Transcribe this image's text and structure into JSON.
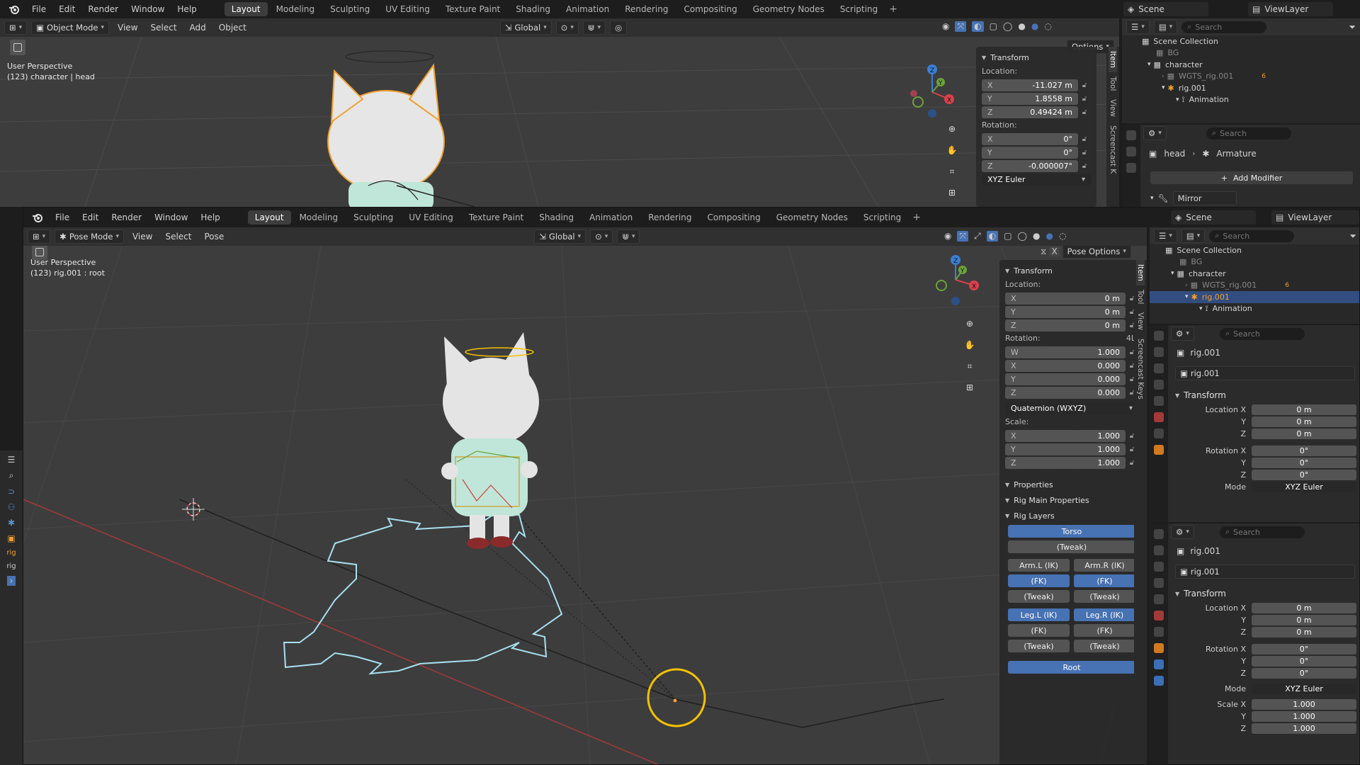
{
  "back": {
    "menus": [
      "File",
      "Edit",
      "Render",
      "Window",
      "Help"
    ],
    "workspaces": [
      "Layout",
      "Modeling",
      "Sculpting",
      "UV Editing",
      "Texture Paint",
      "Shading",
      "Animation",
      "Rendering",
      "Compositing",
      "Geometry Nodes",
      "Scripting"
    ],
    "active_workspace": "Layout",
    "scene": "Scene",
    "view_layer": "ViewLayer",
    "mode": "Object Mode",
    "header_menus": [
      "View",
      "Select",
      "Add",
      "Object"
    ],
    "orientation": "Global",
    "options": "Options",
    "overlay_line1": "User Perspective",
    "overlay_line2": "(123) character | head",
    "transform": {
      "title": "Transform",
      "location_label": "Location:",
      "loc": [
        {
          "ax": "X",
          "v": "-11.027 m"
        },
        {
          "ax": "Y",
          "v": "1.8558 m"
        },
        {
          "ax": "Z",
          "v": "0.49424 m"
        }
      ],
      "rotation_label": "Rotation:",
      "rot": [
        {
          "ax": "X",
          "v": "0°"
        },
        {
          "ax": "Y",
          "v": "0°"
        },
        {
          "ax": "Z",
          "v": "-0.000007°"
        }
      ],
      "rot_mode": "XYZ Euler"
    },
    "side_tabs": [
      "Item",
      "Tool",
      "View",
      "Screencast K"
    ],
    "outliner": {
      "search": "Search",
      "scene_collection": "Scene Collection",
      "items": [
        "BG",
        "character",
        "WGTS_rig.001",
        "rig.001",
        "Animation"
      ],
      "badge": "6"
    },
    "props": {
      "search": "Search",
      "object": "head",
      "data": "Armature",
      "add_modifier": "Add Modifier",
      "modifier": "Mirror"
    }
  },
  "front": {
    "menus": [
      "File",
      "Edit",
      "Render",
      "Window",
      "Help"
    ],
    "workspaces": [
      "Layout",
      "Modeling",
      "Sculpting",
      "UV Editing",
      "Texture Paint",
      "Shading",
      "Animation",
      "Rendering",
      "Compositing",
      "Geometry Nodes",
      "Scripting"
    ],
    "active_workspace": "Layout",
    "scene": "Scene",
    "view_layer": "ViewLayer",
    "mode": "Pose Mode",
    "header_menus": [
      "View",
      "Select",
      "Pose"
    ],
    "orientation": "Global",
    "pose_options": "Pose Options",
    "overlay_line1": "User Perspective",
    "overlay_line2": "(123) rig.001 : root",
    "transform": {
      "title": "Transform",
      "location_label": "Location:",
      "loc": [
        {
          "ax": "X",
          "v": "0 m"
        },
        {
          "ax": "Y",
          "v": "0 m"
        },
        {
          "ax": "Z",
          "v": "0 m"
        }
      ],
      "rotation_label": "Rotation:",
      "rot_tag": "4L",
      "rot": [
        {
          "ax": "W",
          "v": "1.000"
        },
        {
          "ax": "X",
          "v": "0.000"
        },
        {
          "ax": "Y",
          "v": "0.000"
        },
        {
          "ax": "Z",
          "v": "0.000"
        }
      ],
      "rot_mode": "Quaternion (WXYZ)",
      "scale_label": "Scale:",
      "scale": [
        {
          "ax": "X",
          "v": "1.000"
        },
        {
          "ax": "Y",
          "v": "1.000"
        },
        {
          "ax": "Z",
          "v": "1.000"
        }
      ]
    },
    "panels": [
      "Properties",
      "Rig Main Properties",
      "Rig Layers"
    ],
    "rig_layers": {
      "torso": "Torso",
      "torso_tweak": "(Tweak)",
      "arm_l_ik": "Arm.L (IK)",
      "arm_r_ik": "Arm.R (IK)",
      "arm_l_fk": "(FK)",
      "arm_r_fk": "(FK)",
      "arm_l_tweak": "(Tweak)",
      "arm_r_tweak": "(Tweak)",
      "leg_l_ik": "Leg.L (IK)",
      "leg_r_ik": "Leg.R (IK)",
      "leg_l_fk": "(FK)",
      "leg_r_fk": "(FK)",
      "leg_l_tweak": "(Tweak)",
      "leg_r_tweak": "(Tweak)",
      "root": "Root"
    },
    "side_tabs": [
      "Item",
      "Tool",
      "View",
      "Screencast Keys"
    ],
    "outliner": {
      "search": "Search",
      "scene_collection": "Scene Collection",
      "items": [
        "BG",
        "character",
        "WGTS_rig.001",
        "rig.001",
        "Animation"
      ],
      "badge": "6"
    },
    "props1": {
      "search": "Search",
      "object": "rig.001",
      "data": "rig.001",
      "transform": "Transform",
      "location_x": "Location X",
      "rotation_x": "Rotation X",
      "y": "Y",
      "z": "Z",
      "mode_label": "Mode",
      "loc": [
        "0 m",
        "0 m",
        "0 m"
      ],
      "rot": [
        "0°",
        "0°",
        "0°"
      ],
      "mode": "XYZ Euler"
    },
    "props2": {
      "search": "Search",
      "object": "rig.001",
      "data": "rig.001",
      "transform": "Transform",
      "location_x": "Location X",
      "rotation_x": "Rotation X",
      "y": "Y",
      "z": "Z",
      "mode_label": "Mode",
      "scale_x": "Scale X",
      "loc": [
        "0 m",
        "0 m",
        "0 m"
      ],
      "rot": [
        "0°",
        "0°",
        "0°"
      ],
      "mode": "XYZ Euler",
      "scale": [
        "1.000",
        "1.000",
        "1.000"
      ]
    },
    "left_strip": [
      "rig",
      "rig"
    ]
  },
  "colors": {
    "accent_blue": "#4772b3",
    "selection_orange": "#f0a030",
    "highlight_yellow": "#f2c200",
    "widget_cyan": "#a8e0f0",
    "axis_red": "#c03a3a",
    "viewport_bg": "#3d3d3d"
  },
  "gizmo": {
    "x": "X",
    "y": "Y",
    "z": "Z"
  }
}
